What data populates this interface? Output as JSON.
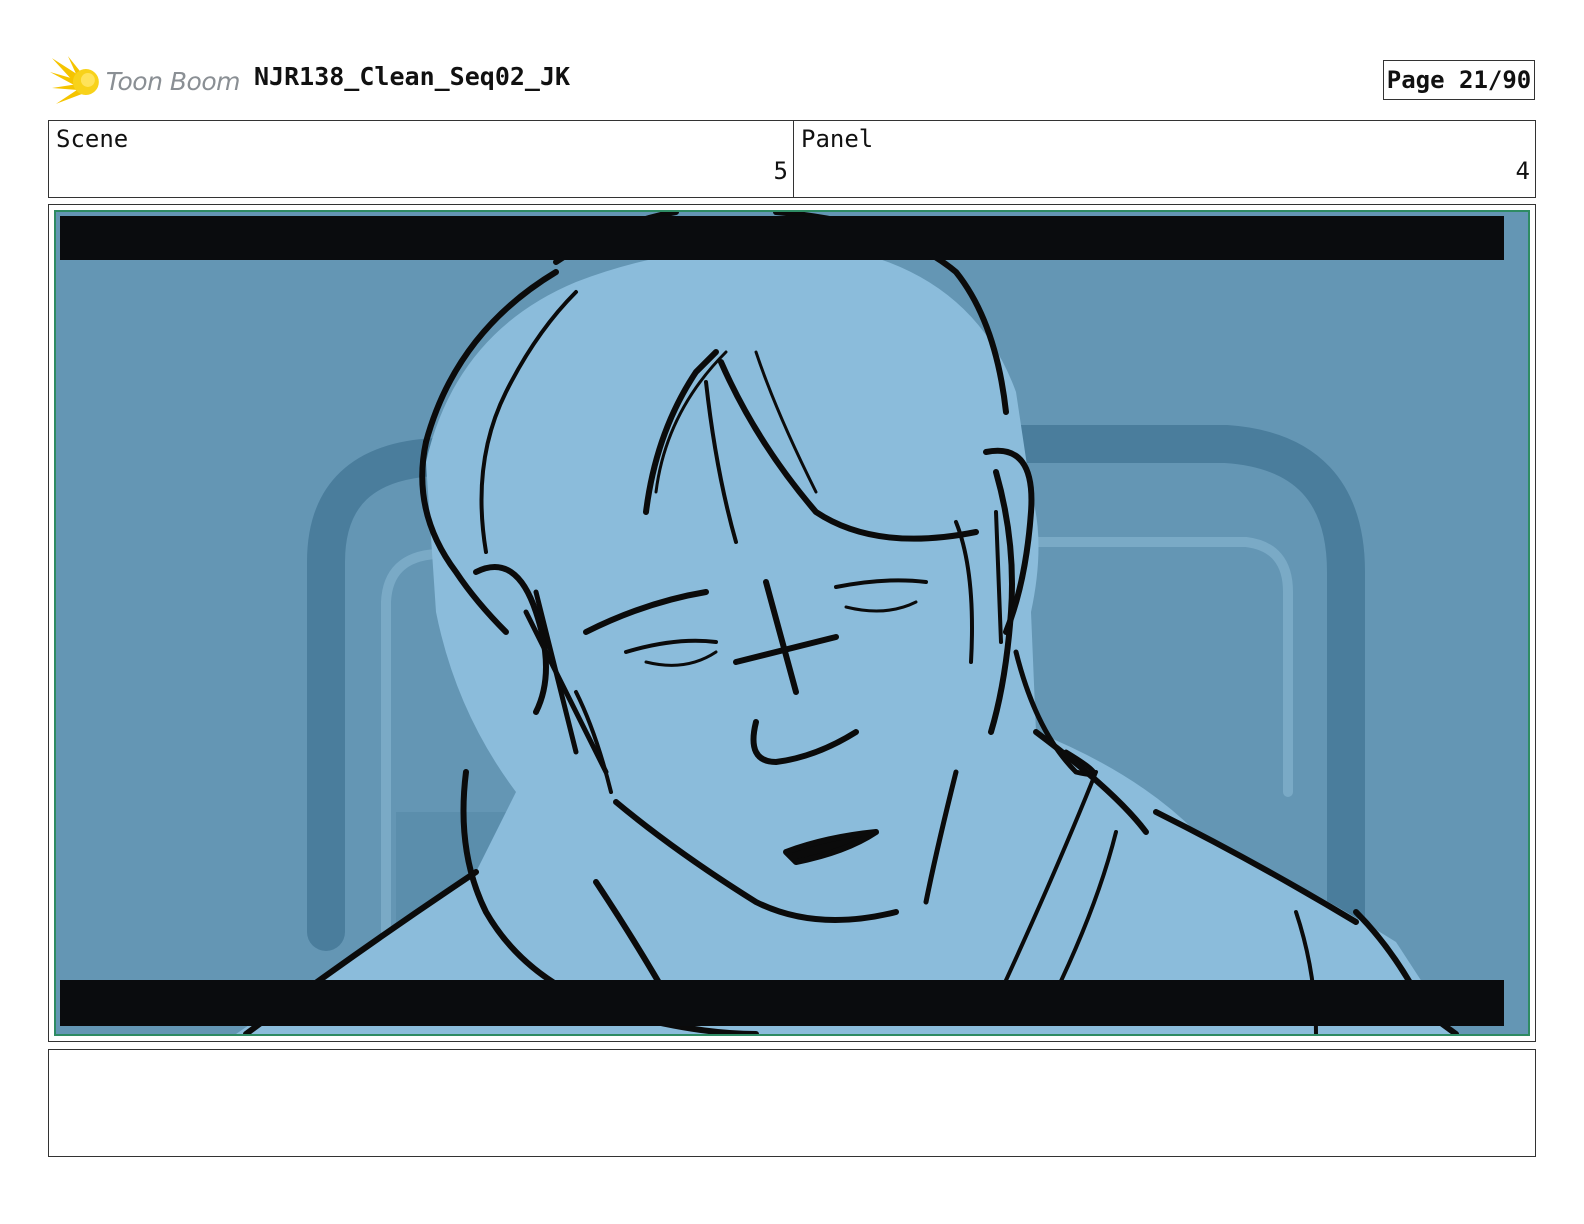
{
  "header": {
    "logo_text": "Toon Boom",
    "document_title": "NJR138_Clean_Seq02_JK",
    "page_label": "Page 21/90"
  },
  "info": {
    "scene_label": "Scene",
    "scene_value": "5",
    "panel_label": "Panel",
    "panel_value": "4"
  },
  "frame": {
    "background_color": "#6496b4",
    "figure_color": "#8bbcdb",
    "seat_color": "#4a7d9c",
    "letterbox_color": "#0a0c0e",
    "border_color": "#2e8b63"
  },
  "notes": {
    "text": ""
  }
}
